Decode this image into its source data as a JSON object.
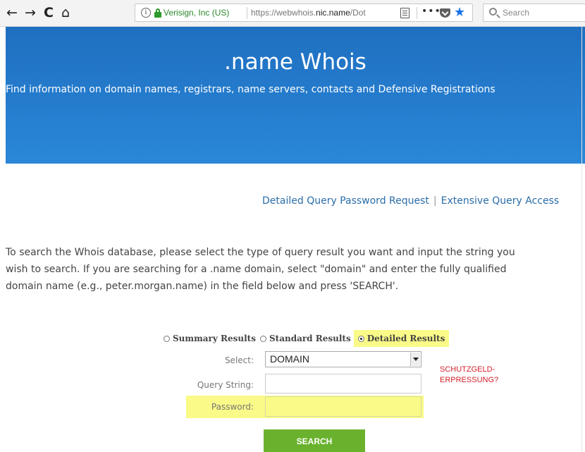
{
  "browser": {
    "back_icon": "←",
    "forward_icon": "→",
    "reload_icon": "C",
    "home_icon": "⌂",
    "identity_org": "Verisign, Inc (US)",
    "url_prefix": "https://webwhois.",
    "url_domain": "nic.name",
    "url_suffix": "/Dot",
    "more_icon": "•••",
    "star_icon": "★",
    "search_placeholder": "Search"
  },
  "banner": {
    "title": ".name Whois",
    "subtitle": "Find information on domain names, registrars, name servers, contacts and Defensive Registrations"
  },
  "links": {
    "detailed_query_password": "Detailed Query Password Request",
    "separator": "|",
    "extensive_query_access": "Extensive Query Access"
  },
  "description": {
    "line1": "To search the Whois database, please select the type of query result you want and input the string you",
    "line2": "wish to search. If you are searching for a .name domain, select \"domain\" and enter the fully qualified",
    "line3": "domain name (e.g., peter.morgan.name) in the field below and press 'SEARCH'."
  },
  "form": {
    "radio_summary": "Summary Results",
    "radio_standard": "Standard Results",
    "radio_detailed": "Detailed Results",
    "selected_radio": "Detailed Results",
    "select_label": "Select:",
    "select_value": "DOMAIN",
    "query_label": "Query String:",
    "query_value": "",
    "password_label": "Password:",
    "password_value": "",
    "search_button": "SEARCH",
    "highlight_color": "#fafa88",
    "button_color": "#6ab22e"
  },
  "annotation": {
    "line1": "SCHUTZGELD-",
    "line2": "ERPRESSUNG?",
    "color": "#d2202a"
  }
}
